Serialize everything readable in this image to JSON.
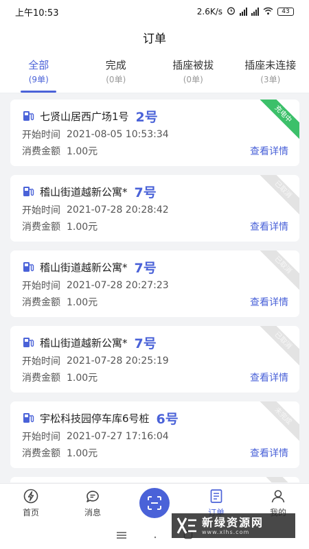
{
  "status_bar": {
    "time": "上午10:53",
    "speed": "2.6K/s",
    "battery": "43"
  },
  "header": {
    "title": "订单"
  },
  "tabs": [
    {
      "label": "全部",
      "count": "(9单)",
      "active": true
    },
    {
      "label": "完成",
      "count": "(0单)",
      "active": false
    },
    {
      "label": "插座被拔",
      "count": "(0单)",
      "active": false
    },
    {
      "label": "插座未连接",
      "count": "(3单)",
      "active": false
    }
  ],
  "field_labels": {
    "start_time": "开始时间",
    "amount": "消费金额",
    "detail": "查看详情"
  },
  "orders": [
    {
      "station": "七贤山居西广场1号",
      "plug": "2号",
      "start_time": "2021-08-05 10:53:34",
      "amount": "1.00元",
      "badge": "充电中",
      "badge_color": "#3cc06a"
    },
    {
      "station": "稽山街道越新公寓*",
      "plug": "7号",
      "start_time": "2021-07-28 20:28:42",
      "amount": "1.00元",
      "badge": "已取消",
      "badge_color": "#e3e3e3"
    },
    {
      "station": "稽山街道越新公寓*",
      "plug": "7号",
      "start_time": "2021-07-28 20:27:23",
      "amount": "1.00元",
      "badge": "已取消",
      "badge_color": "#e3e3e3"
    },
    {
      "station": "稽山街道越新公寓*",
      "plug": "7号",
      "start_time": "2021-07-28 20:25:19",
      "amount": "1.00元",
      "badge": "已取消",
      "badge_color": "#e3e3e3"
    },
    {
      "station": "宇松科技园停车库6号桩",
      "plug": "6号",
      "start_time": "2021-07-27 17:16:04",
      "amount": "1.00元",
      "badge": "未完成",
      "badge_color": "#e3e3e3"
    }
  ],
  "bottom_nav": {
    "home": "首页",
    "messages": "消息",
    "orders": "订单",
    "mine": "我的"
  },
  "watermark": {
    "title": "新绿资源网",
    "url": "www.xlhs.com"
  },
  "colors": {
    "accent": "#4a62d8",
    "charging": "#3cc06a",
    "background": "#f2f3f5"
  }
}
